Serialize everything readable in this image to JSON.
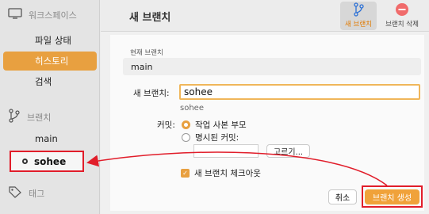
{
  "sidebar": {
    "workspace_label": "워크스페이스",
    "items": [
      {
        "label": "파일 상태"
      },
      {
        "label": "히스토리"
      },
      {
        "label": "검색"
      }
    ],
    "branches_label": "브랜치",
    "branches": [
      {
        "label": "main"
      },
      {
        "label": "sohee"
      }
    ],
    "tags_label": "태그"
  },
  "header": {
    "title": "새 브랜치",
    "new_branch_btn": "새 브랜치",
    "delete_branch_btn": "브랜치 삭제"
  },
  "form": {
    "current_branch_label": "현재 브랜치",
    "current_branch_value": "main",
    "new_branch_label": "새 브랜치:",
    "new_branch_value": "sohee",
    "new_branch_hint": "sohee",
    "commit_label": "커밋:",
    "radio_working_copy": "작업 사본 부모",
    "radio_specified_commit": "명시된 커밋:",
    "pick_button": "고르기...",
    "checkout_checkbox": "새 브랜치 체크아웃",
    "checkout_checked": true
  },
  "footer": {
    "cancel": "취소",
    "create": "브랜치 생성"
  },
  "colors": {
    "accent": "#e8a040",
    "highlight_box": "#e11d2a"
  }
}
